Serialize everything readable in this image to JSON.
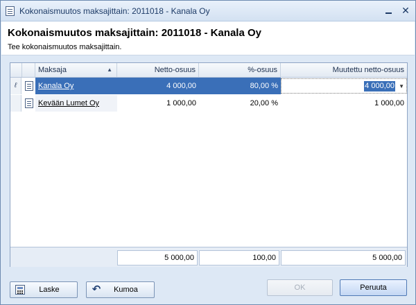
{
  "window": {
    "title": "Kokonaismuutos maksajittain: 2011018 - Kanala Oy",
    "close_glyph": "✕"
  },
  "header": {
    "title": "Kokonaismuutos maksajittain: 2011018 - Kanala Oy",
    "subtitle": "Tee kokonaismuutos maksajittain."
  },
  "grid": {
    "columns": {
      "payer": "Maksaja",
      "net_share": "Netto-osuus",
      "percent": "%-osuus",
      "changed_net": "Muutettu netto-osuus"
    },
    "sort_indicator": "▲",
    "edit_indicator": "ℓ",
    "rows": [
      {
        "payer": "Kanala Oy",
        "net_share": "4 000,00",
        "percent": "80,00 %",
        "changed_net": "4 000,00"
      },
      {
        "payer": "Kevään Lumet Oy",
        "net_share": "1 000,00",
        "percent": "20,00 %",
        "changed_net": "1 000,00"
      }
    ],
    "dropdown_glyph": "▼",
    "totals": {
      "net_share": "5 000,00",
      "percent": "100,00",
      "changed_net": "5 000,00"
    }
  },
  "buttons": {
    "calculate": "Laske",
    "undo": "Kumoa",
    "undo_glyph": "↶",
    "ok": "OK",
    "cancel": "Peruuta"
  },
  "icons": {
    "window": "document-icon",
    "row": "document-icon",
    "calculate": "calculator-icon",
    "undo": "undo-icon"
  }
}
